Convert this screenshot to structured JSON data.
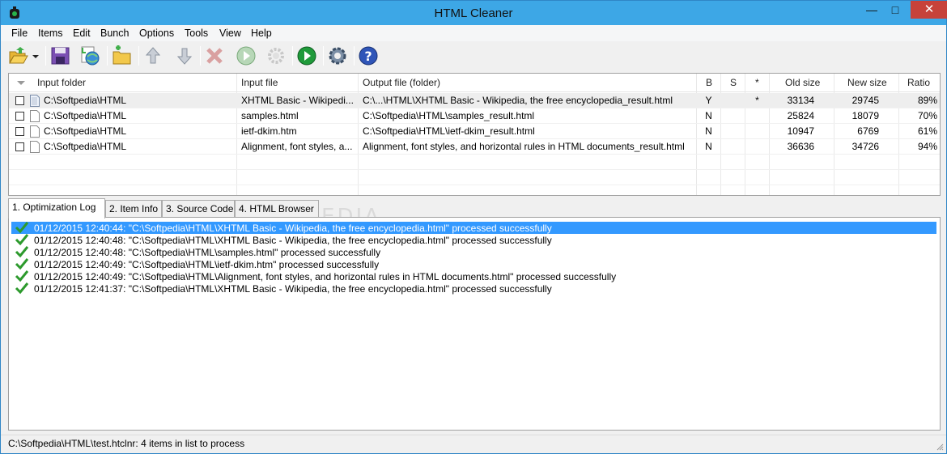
{
  "window": {
    "title": "HTML Cleaner",
    "minimize_glyph": "—",
    "maximize_glyph": "□",
    "close_glyph": "✕"
  },
  "menu": [
    "File",
    "Items",
    "Edit",
    "Bunch",
    "Options",
    "Tools",
    "View",
    "Help"
  ],
  "toolbar": {
    "icons": [
      "open-folder-icon",
      "dropdown-arrow-icon",
      "save-icon",
      "add-from-web-icon",
      "add-folder-icon",
      "move-up-icon",
      "move-down-icon",
      "delete-icon",
      "process-icon",
      "settings-disabled-icon",
      "process-all-icon",
      "options-gear-icon",
      "help-icon"
    ]
  },
  "grid": {
    "columns": [
      "Input folder",
      "Input file",
      "Output file (folder)",
      "B",
      "S",
      "*",
      "Old size",
      "New size",
      "Ratio"
    ],
    "rows": [
      {
        "folder": "C:\\Softpedia\\HTML",
        "file": "XHTML Basic - Wikipedi...",
        "output": "C:\\...\\HTML\\XHTML Basic - Wikipedia, the free encyclopedia_result.html",
        "b": "Y",
        "s": "",
        "star": "*",
        "old": "33134",
        "new": "29745",
        "ratio": "89%"
      },
      {
        "folder": "C:\\Softpedia\\HTML",
        "file": "samples.html",
        "output": "C:\\Softpedia\\HTML\\samples_result.html",
        "b": "N",
        "s": "",
        "star": "",
        "old": "25824",
        "new": "18079",
        "ratio": "70%"
      },
      {
        "folder": "C:\\Softpedia\\HTML",
        "file": "ietf-dkim.htm",
        "output": "C:\\Softpedia\\HTML\\ietf-dkim_result.html",
        "b": "N",
        "s": "",
        "star": "",
        "old": "10947",
        "new": "6769",
        "ratio": "61%"
      },
      {
        "folder": "C:\\Softpedia\\HTML",
        "file": "Alignment, font styles, a...",
        "output": "Alignment, font styles, and horizontal rules in HTML documents_result.html",
        "b": "N",
        "s": "",
        "star": "",
        "old": "36636",
        "new": "34726",
        "ratio": "94%"
      }
    ]
  },
  "tabs": [
    "1. Optimization Log",
    "2. Item Info",
    "3. Source Code",
    "4. HTML Browser"
  ],
  "log": [
    "01/12/2015 12:40:44: \"C:\\Softpedia\\HTML\\XHTML Basic - Wikipedia, the free encyclopedia.html\" processed successfully",
    "01/12/2015 12:40:48: \"C:\\Softpedia\\HTML\\XHTML Basic - Wikipedia, the free encyclopedia.html\" processed successfully",
    "01/12/2015 12:40:48: \"C:\\Softpedia\\HTML\\samples.html\" processed successfully",
    "01/12/2015 12:40:49: \"C:\\Softpedia\\HTML\\ietf-dkim.htm\" processed successfully",
    "01/12/2015 12:40:49: \"C:\\Softpedia\\HTML\\Alignment, font styles, and horizontal rules in HTML documents.html\" processed successfully",
    "01/12/2015 12:41:37: \"C:\\Softpedia\\HTML\\XHTML Basic - Wikipedia, the free encyclopedia.html\" processed successfully"
  ],
  "status": "C:\\Softpedia\\HTML\\test.htclnr: 4 items in list to process",
  "watermark": "SOFTPEDIA",
  "colors": {
    "titlebar": "#3da7e6",
    "close": "#c7423a",
    "selection": "#3399ff"
  }
}
